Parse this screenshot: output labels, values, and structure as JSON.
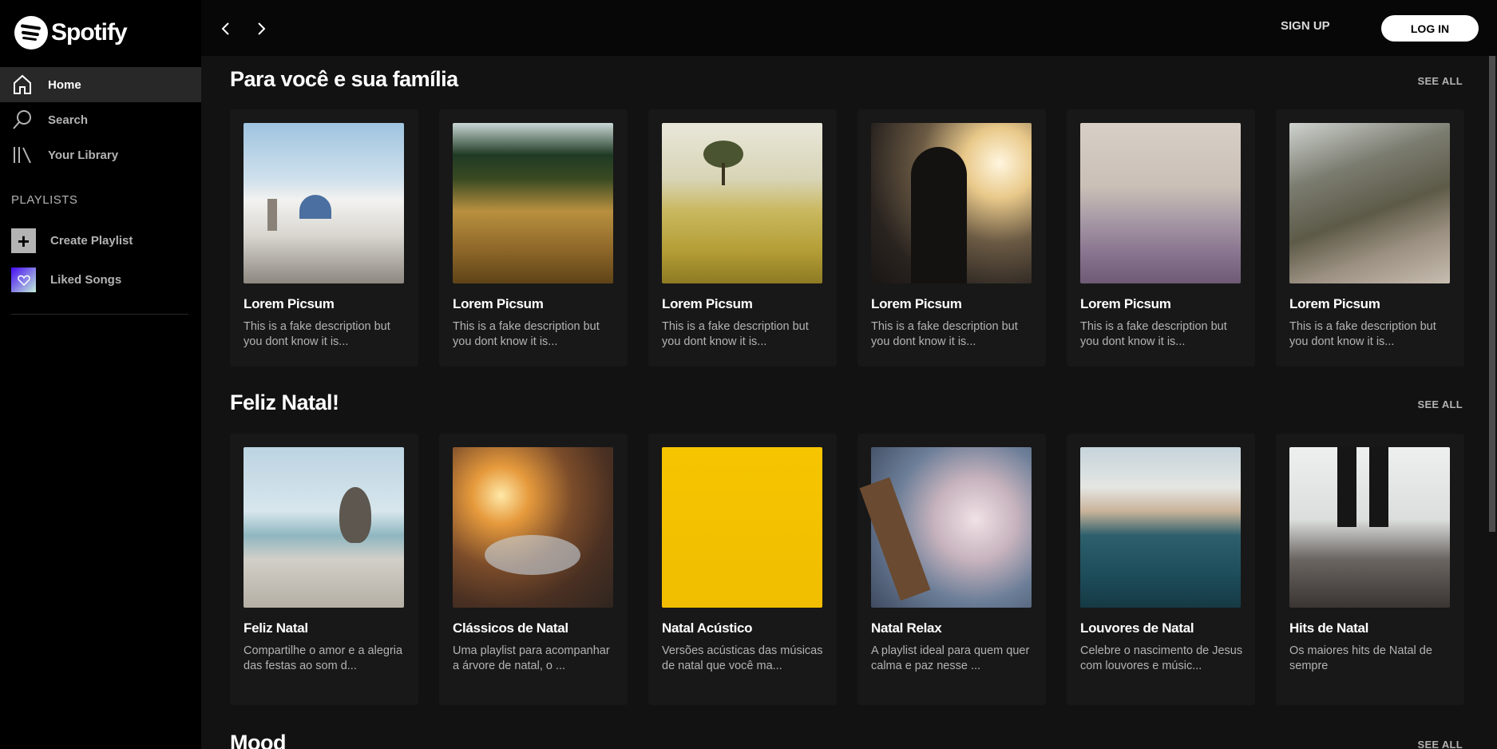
{
  "brand": {
    "name": "Spotify"
  },
  "sidebar": {
    "nav": [
      {
        "label": "Home",
        "icon": "home-icon",
        "active": true
      },
      {
        "label": "Search",
        "icon": "search-icon",
        "active": false
      },
      {
        "label": "Your Library",
        "icon": "library-icon",
        "active": false
      }
    ],
    "playlists_title": "PLAYLISTS",
    "create_playlist": "Create Playlist",
    "liked_songs": "Liked Songs"
  },
  "topbar": {
    "back_icon": "chevron-left-icon",
    "forward_icon": "chevron-right-icon",
    "signup": "SIGN UP",
    "login": "LOG IN"
  },
  "sections": [
    {
      "title": "Para você e sua família",
      "see_all": "SEE ALL",
      "cards": [
        {
          "title": "Lorem Picsum",
          "desc": "This is a fake description but you dont know it is...",
          "image": "whitewashed village by the sea"
        },
        {
          "title": "Lorem Picsum",
          "desc": "This is a fake description but you dont know it is...",
          "image": "golden wheat field"
        },
        {
          "title": "Lorem Picsum",
          "desc": "This is a fake description but you dont know it is...",
          "image": "lone tree in yellow meadow"
        },
        {
          "title": "Lorem Picsum",
          "desc": "This is a fake description but you dont know it is...",
          "image": "person silhouetted against sunset"
        },
        {
          "title": "Lorem Picsum",
          "desc": "This is a fake description but you dont know it is...",
          "image": "misty beach shoreline"
        },
        {
          "title": "Lorem Picsum",
          "desc": "This is a fake description but you dont know it is...",
          "image": "dirt road through forest"
        }
      ]
    },
    {
      "title": "Feliz Natal!",
      "see_all": "SEE ALL",
      "cards": [
        {
          "title": "Feliz Natal",
          "desc": "Compartilhe o amor e a alegria das festas ao som d...",
          "image": "pelicans on wooden pier"
        },
        {
          "title": "Clássicos de Natal",
          "desc": "Uma playlist para acompanhar a árvore de natal, o ...",
          "image": "sunset over icy road"
        },
        {
          "title": "Natal Acústico",
          "desc": "Versões acústicas das músicas de natal que você ma...",
          "image": "yellow texture"
        },
        {
          "title": "Natal Relax",
          "desc": "A playlist ideal para quem quer calma e paz nesse ...",
          "image": "baby playing with guitar"
        },
        {
          "title": "Louvores de Natal",
          "desc": "Celebre o nascimento de Jesus com louvores e músic...",
          "image": "sea cliffs and rock formations"
        },
        {
          "title": "Hits de Natal",
          "desc": "Os maiores hits de Natal de sempre",
          "image": "person standing on gravel"
        }
      ]
    },
    {
      "title": "Mood",
      "see_all": "SEE ALL"
    }
  ],
  "colors": {
    "background": "#121212",
    "sidebar": "#000000",
    "card": "#181818",
    "muted_text": "#b3b3b3",
    "active_nav": "#282828"
  }
}
